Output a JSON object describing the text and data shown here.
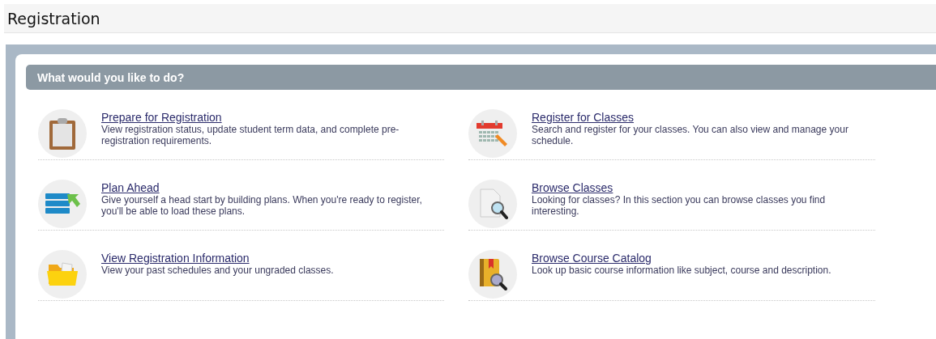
{
  "page_title": "Registration",
  "panel": {
    "heading": "What would you like to do?",
    "items": [
      {
        "kind": "clipboard",
        "title": "Prepare for Registration",
        "description": "View registration status, update student term data, and complete pre-registration requirements."
      },
      {
        "kind": "calendar",
        "title": "Register for Classes",
        "description": "Search and register for your classes. You can also view and manage your schedule."
      },
      {
        "kind": "plan",
        "title": "Plan Ahead",
        "description": "Give yourself a head start by building plans. When you're ready to register, you'll be able to load these plans."
      },
      {
        "kind": "document",
        "title": "Browse Classes",
        "description": "Looking for classes? In this section you can browse classes you find interesting."
      },
      {
        "kind": "folder",
        "title": "View Registration Information",
        "description": "View your past schedules and your ungraded classes."
      },
      {
        "kind": "book",
        "title": "Browse Course Catalog",
        "description": "Look up basic course information like subject, course and description."
      }
    ]
  }
}
